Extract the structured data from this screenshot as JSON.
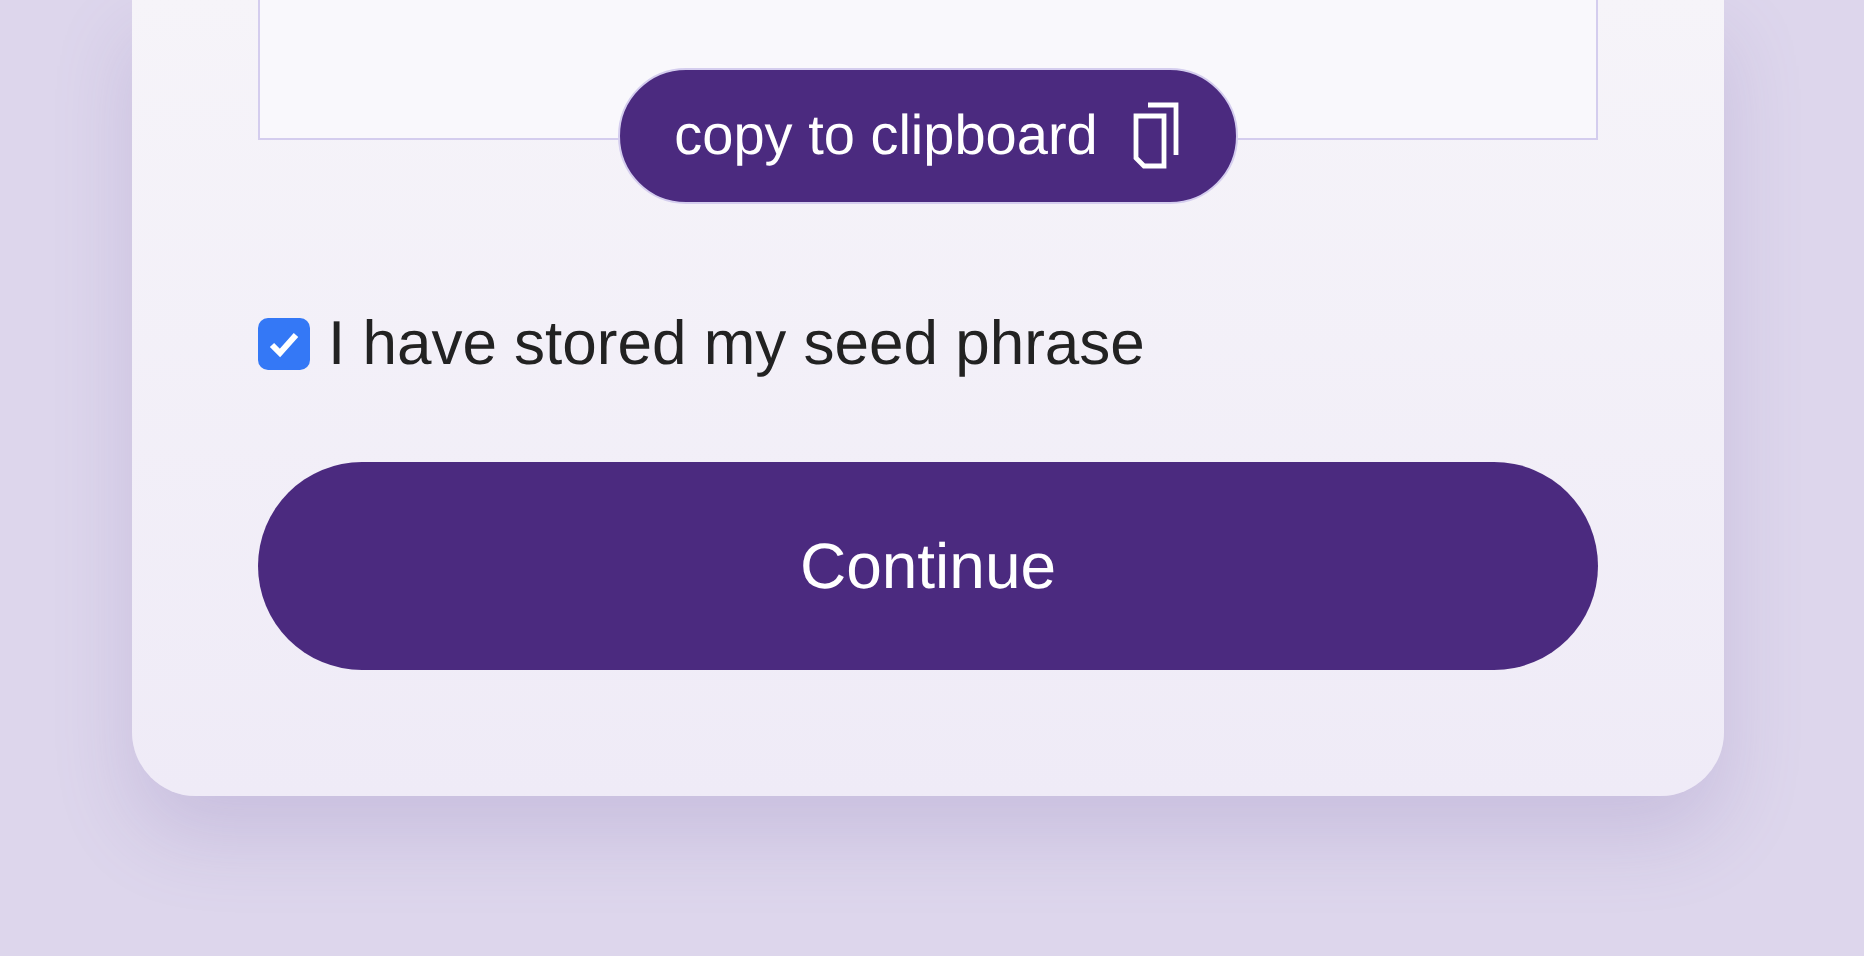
{
  "seed_box": {
    "copy_button": {
      "label": "copy to clipboard"
    }
  },
  "confirmation": {
    "label": "I have stored my seed phrase",
    "checked": true
  },
  "continue_button": {
    "label": "Continue"
  }
}
